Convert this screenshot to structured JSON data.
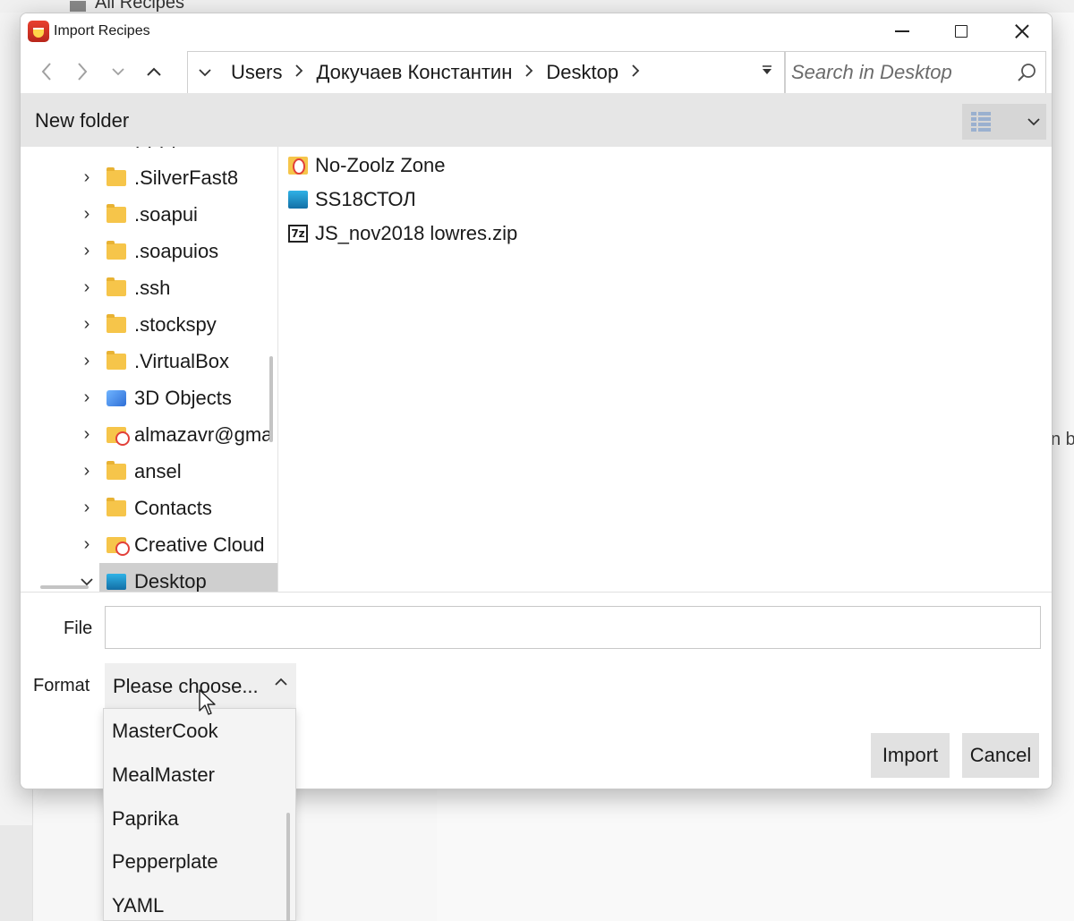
{
  "background": {
    "header_title": "All Recipes",
    "partial_text": "n b"
  },
  "dialog": {
    "title": "Import Recipes",
    "window_controls": {
      "minimize_icon": "minimize-icon",
      "maximize_icon": "maximize-icon",
      "close_icon": "close-icon"
    },
    "nav": {
      "back_icon": "back-arrow-icon",
      "forward_icon": "forward-arrow-icon",
      "recent_icon": "chevron-down-icon",
      "up_icon": "up-arrow-icon"
    },
    "address": {
      "segments": [
        "Users",
        "Докучаев Константин",
        "Desktop"
      ]
    },
    "search": {
      "placeholder": "Search in Desktop"
    },
    "toolbar": {
      "new_folder": "New folder",
      "view_icon": "view-options-icon"
    },
    "tree": {
      "items": [
        {
          "label": ".SilverFast8",
          "icon": "folder-icon"
        },
        {
          "label": ".soapui",
          "icon": "folder-icon"
        },
        {
          "label": ".soapuios",
          "icon": "folder-icon"
        },
        {
          "label": ".ssh",
          "icon": "folder-icon"
        },
        {
          "label": ".stockspy",
          "icon": "folder-icon"
        },
        {
          "label": ".VirtualBox",
          "icon": "folder-icon"
        },
        {
          "label": "3D Objects",
          "icon": "3d-objects-icon"
        },
        {
          "label": "almazavr@gma",
          "icon": "creative-cloud-folder-icon"
        },
        {
          "label": "ansel",
          "icon": "folder-icon"
        },
        {
          "label": "Contacts",
          "icon": "folder-icon"
        },
        {
          "label": "Creative Cloud",
          "icon": "creative-cloud-folder-icon"
        },
        {
          "label": "Desktop",
          "icon": "desktop-icon",
          "selected": true
        }
      ]
    },
    "files": [
      {
        "name": "No-Zoolz Zone",
        "icon": "zoolz-folder-icon"
      },
      {
        "name": "SS18СТОЛ",
        "icon": "desktop-shortcut-icon"
      },
      {
        "name": "JS_nov2018 lowres.zip",
        "icon": "7z-archive-icon"
      }
    ],
    "form": {
      "file_label": "File",
      "file_value": "",
      "format_label": "Format",
      "format_value": "Please choose...",
      "format_options": [
        "MasterCook",
        "MealMaster",
        "Paprika",
        "Pepperplate",
        "YAML"
      ]
    },
    "buttons": {
      "import": "Import",
      "cancel": "Cancel"
    }
  }
}
